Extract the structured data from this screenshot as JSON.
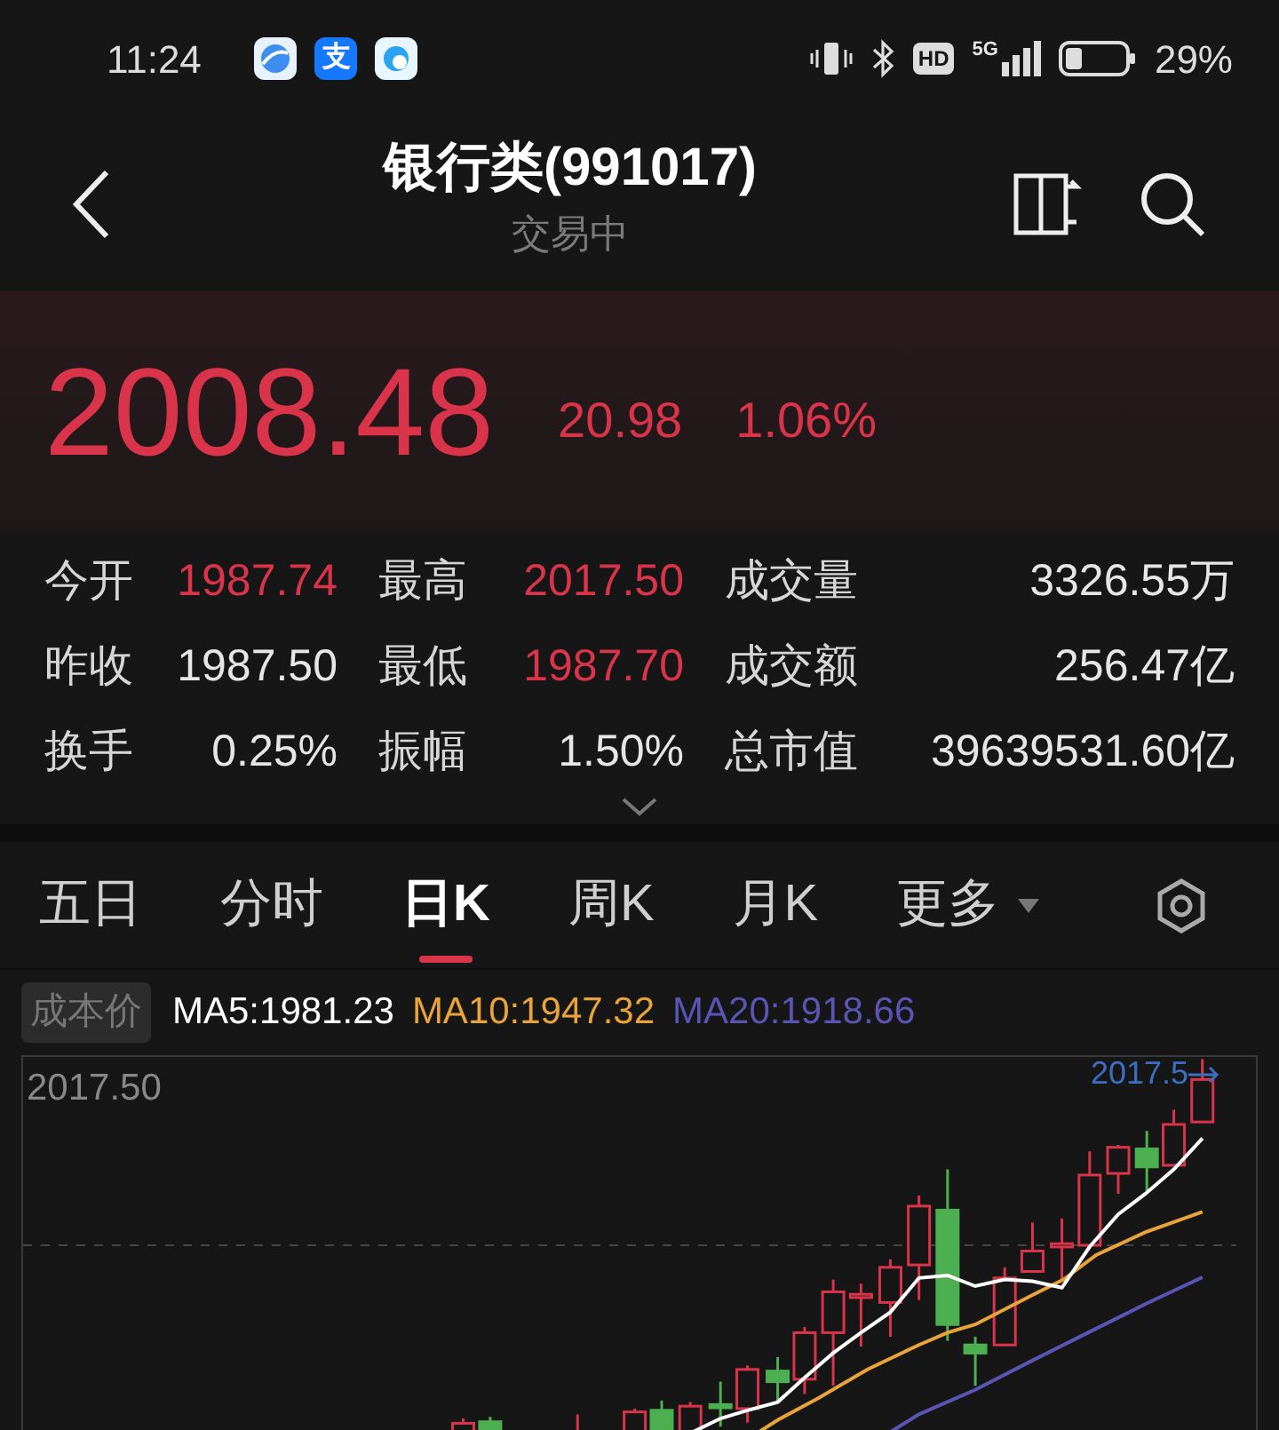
{
  "status_bar": {
    "time": "11:24",
    "app_icons": [
      {
        "kind": "browser"
      },
      {
        "kind": "alipay",
        "glyph": "支"
      },
      {
        "kind": "cloud"
      }
    ],
    "hd": "HD",
    "network": "5G",
    "battery": "29%"
  },
  "header": {
    "title": "银行类(991017)",
    "subtitle": "交易中"
  },
  "quote": {
    "price": "2008.48",
    "change": "20.98",
    "change_pct": "1.06%",
    "rising": true
  },
  "stats": [
    {
      "label": "今开",
      "value": "1987.74",
      "rising": true
    },
    {
      "label": "最高",
      "value": "2017.50",
      "rising": true
    },
    {
      "label": "成交量",
      "value": "3326.55万",
      "rising": false
    },
    {
      "label": "昨收",
      "value": "1987.50",
      "rising": false
    },
    {
      "label": "最低",
      "value": "1987.70",
      "rising": true
    },
    {
      "label": "成交额",
      "value": "256.47亿",
      "rising": false
    },
    {
      "label": "换手",
      "value": "0.25%",
      "rising": false
    },
    {
      "label": "振幅",
      "value": "1.50%",
      "rising": false
    },
    {
      "label": "总市值",
      "value": "39639531.60亿",
      "rising": false
    }
  ],
  "tabs": [
    {
      "label": "五日",
      "selected": false,
      "has_menu": false
    },
    {
      "label": "分时",
      "selected": false,
      "has_menu": false
    },
    {
      "label": "日K",
      "selected": true,
      "has_menu": false
    },
    {
      "label": "周K",
      "selected": false,
      "has_menu": false
    },
    {
      "label": "月K",
      "selected": false,
      "has_menu": false
    },
    {
      "label": "更多",
      "selected": false,
      "has_menu": true
    }
  ],
  "cost_badge": "成本价",
  "ma_legend": [
    {
      "label": "MA5:1981.23",
      "color": "#ffffff"
    },
    {
      "label": "MA10:1947.32",
      "color": "#e8a33a"
    },
    {
      "label": "MA20:1918.66",
      "color": "#5a55b5"
    }
  ],
  "chart": {
    "top_label": "2017.50",
    "high_marker": "2017.5"
  }
}
